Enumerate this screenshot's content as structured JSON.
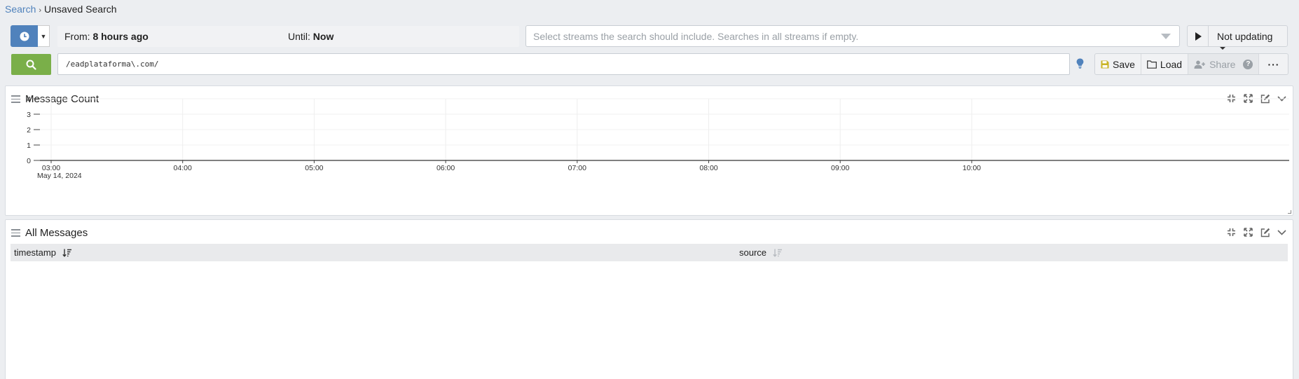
{
  "breadcrumb": {
    "root": "Search",
    "current": "Unsaved Search"
  },
  "time_range": {
    "from_label": "From:",
    "from_value": "8 hours ago",
    "until_label": "Until:",
    "until_value": "Now"
  },
  "streams": {
    "placeholder": "Select streams the search should include. Searches in all streams if empty."
  },
  "refresh": {
    "label": "Not updating"
  },
  "query": {
    "value": "/eadplataforma\\.com/"
  },
  "actions": {
    "save": "Save",
    "load": "Load",
    "share": "Share",
    "help": "?",
    "more": "···"
  },
  "colors": {
    "accent": "#5082bc",
    "search": "#7aaf49",
    "save_icon": "#c9b325",
    "bulb": "#5082bc"
  },
  "widgets": {
    "message_count": {
      "title": "Message Count"
    },
    "all_messages": {
      "title": "All Messages",
      "columns": [
        {
          "label": "timestamp",
          "sorted": true
        },
        {
          "label": "source",
          "sorted": false
        }
      ]
    }
  },
  "chart_data": {
    "type": "line",
    "title": "Message Count",
    "x_ticks": [
      "03:00",
      "04:00",
      "05:00",
      "06:00",
      "07:00",
      "08:00",
      "09:00",
      "10:00"
    ],
    "x_date_label": "May 14, 2024",
    "y_ticks": [
      0,
      1,
      2,
      3,
      4
    ],
    "ylim": [
      0,
      4
    ],
    "series": [],
    "grid": true
  }
}
